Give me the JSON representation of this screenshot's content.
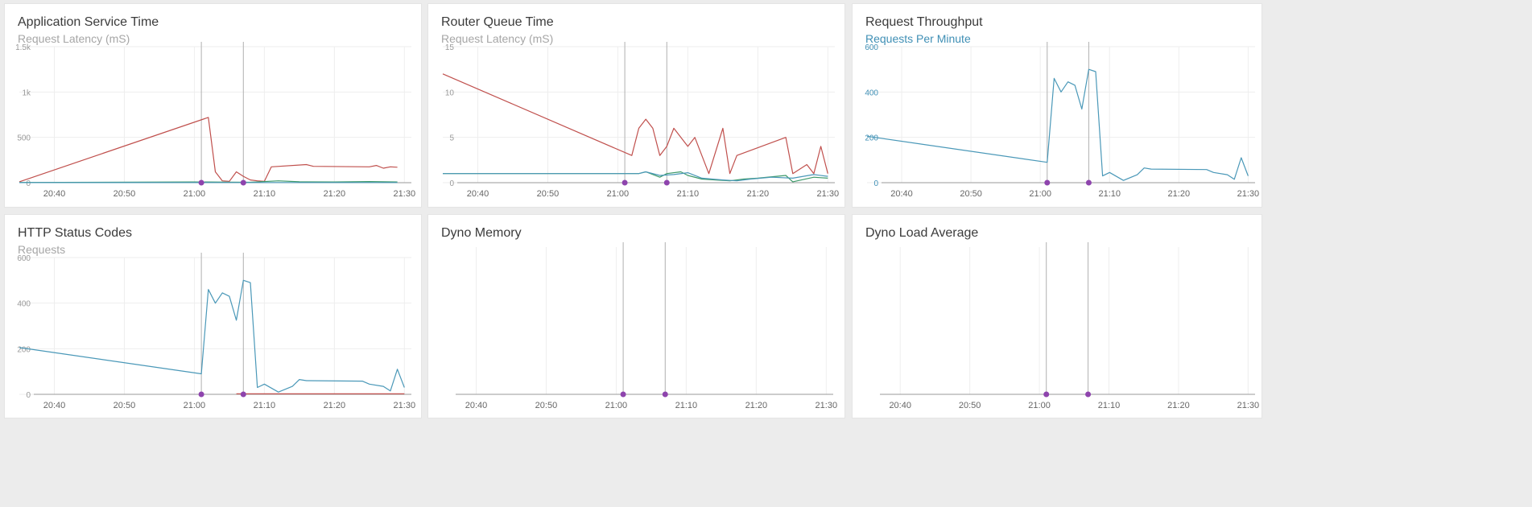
{
  "colors": {
    "red": "#c0504d",
    "green": "#3e9a6a",
    "blue": "#4a98b8",
    "marker": "#8e44ad",
    "grid": "#eeeeee",
    "baseline": "#9a9a9a",
    "event": "#b0b0b0"
  },
  "events": [
    "21:01",
    "21:07"
  ],
  "xticks": [
    "20:40",
    "20:50",
    "21:00",
    "21:10",
    "21:20",
    "21:30"
  ],
  "panels": [
    {
      "title": "Application Service Time",
      "subtitle": "Request Latency (mS)",
      "subtitle_accent": false
    },
    {
      "title": "Router Queue Time",
      "subtitle": "Request Latency (mS)",
      "subtitle_accent": false
    },
    {
      "title": "Request Throughput",
      "subtitle": "Requests Per Minute",
      "subtitle_accent": true
    },
    {
      "title": "HTTP Status Codes",
      "subtitle": "Requests",
      "subtitle_accent": false
    },
    {
      "title": "Dyno Memory",
      "subtitle": "",
      "subtitle_accent": false
    },
    {
      "title": "Dyno Load Average",
      "subtitle": "",
      "subtitle_accent": false
    }
  ],
  "chart_data": [
    {
      "type": "line",
      "title": "Application Service Time",
      "subtitle": "Request Latency (mS)",
      "x_range": [
        "20:35",
        "21:31"
      ],
      "ylim": [
        0,
        1500
      ],
      "yticks": [
        "0",
        "500",
        "1k",
        "1.5k"
      ],
      "ytick_values": [
        0,
        500,
        1000,
        1500
      ],
      "series": [
        {
          "color": "red",
          "points": [
            [
              "20:35",
              10
            ],
            [
              "21:02",
              720
            ],
            [
              "21:03",
              120
            ],
            [
              "21:04",
              20
            ],
            [
              "21:05",
              15
            ],
            [
              "21:06",
              120
            ],
            [
              "21:07",
              70
            ],
            [
              "21:08",
              30
            ],
            [
              "21:09",
              20
            ],
            [
              "21:10",
              15
            ],
            [
              "21:11",
              175
            ],
            [
              "21:16",
              200
            ],
            [
              "21:17",
              180
            ],
            [
              "21:25",
              175
            ],
            [
              "21:26",
              190
            ],
            [
              "21:27",
              160
            ],
            [
              "21:28",
              175
            ],
            [
              "21:29",
              170
            ]
          ]
        },
        {
          "color": "green",
          "points": [
            [
              "20:35",
              3
            ],
            [
              "21:00",
              8
            ],
            [
              "21:05",
              6
            ],
            [
              "21:08",
              4
            ],
            [
              "21:12",
              20
            ],
            [
              "21:15",
              10
            ],
            [
              "21:20",
              8
            ],
            [
              "21:25",
              12
            ],
            [
              "21:29",
              8
            ]
          ]
        },
        {
          "color": "blue",
          "points": [
            [
              "20:35",
              1
            ],
            [
              "21:05",
              2
            ],
            [
              "21:29",
              2
            ]
          ]
        }
      ]
    },
    {
      "type": "line",
      "title": "Router Queue Time",
      "subtitle": "Request Latency (mS)",
      "x_range": [
        "20:35",
        "21:31"
      ],
      "ylim": [
        0,
        15
      ],
      "yticks": [
        "0",
        "5",
        "10",
        "15"
      ],
      "ytick_values": [
        0,
        5,
        10,
        15
      ],
      "series": [
        {
          "color": "red",
          "points": [
            [
              "20:35",
              12
            ],
            [
              "21:02",
              3
            ],
            [
              "21:03",
              6
            ],
            [
              "21:04",
              7
            ],
            [
              "21:05",
              6
            ],
            [
              "21:06",
              3
            ],
            [
              "21:07",
              4
            ],
            [
              "21:08",
              6
            ],
            [
              "21:10",
              4
            ],
            [
              "21:11",
              5
            ],
            [
              "21:13",
              1
            ],
            [
              "21:15",
              6
            ],
            [
              "21:16",
              1
            ],
            [
              "21:17",
              3
            ],
            [
              "21:24",
              5
            ],
            [
              "21:25",
              1
            ],
            [
              "21:27",
              2
            ],
            [
              "21:28",
              1
            ],
            [
              "21:29",
              4
            ],
            [
              "21:30",
              1
            ]
          ]
        },
        {
          "color": "green",
          "points": [
            [
              "20:35",
              1
            ],
            [
              "21:03",
              1
            ],
            [
              "21:04",
              1.2
            ],
            [
              "21:06",
              0.6
            ],
            [
              "21:07",
              1
            ],
            [
              "21:09",
              1.2
            ],
            [
              "21:10",
              0.8
            ],
            [
              "21:12",
              0.4
            ],
            [
              "21:14",
              0.3
            ],
            [
              "21:16",
              0.2
            ],
            [
              "21:18",
              0.4
            ],
            [
              "21:20",
              0.5
            ],
            [
              "21:24",
              0.8
            ],
            [
              "21:25",
              0.1
            ],
            [
              "21:28",
              0.6
            ],
            [
              "21:30",
              0.5
            ]
          ]
        },
        {
          "color": "blue",
          "points": [
            [
              "20:35",
              1
            ],
            [
              "21:03",
              1
            ],
            [
              "21:04",
              1.2
            ],
            [
              "21:06",
              0.8
            ],
            [
              "21:08",
              0.9
            ],
            [
              "21:10",
              1.1
            ],
            [
              "21:12",
              0.5
            ],
            [
              "21:15",
              0.3
            ],
            [
              "21:17",
              0.2
            ],
            [
              "21:19",
              0.4
            ],
            [
              "21:22",
              0.6
            ],
            [
              "21:25",
              0.5
            ],
            [
              "21:28",
              0.9
            ],
            [
              "21:30",
              0.7
            ]
          ]
        }
      ]
    },
    {
      "type": "line",
      "title": "Request Throughput",
      "subtitle": "Requests Per Minute",
      "x_range": [
        "20:35",
        "21:31"
      ],
      "ylim": [
        0,
        600
      ],
      "yticks": [
        "0",
        "200",
        "400",
        "600"
      ],
      "ytick_values": [
        0,
        200,
        400,
        600
      ],
      "series": [
        {
          "color": "blue",
          "points": [
            [
              "20:35",
              205
            ],
            [
              "21:01",
              90
            ],
            [
              "21:02",
              460
            ],
            [
              "21:03",
              400
            ],
            [
              "21:04",
              445
            ],
            [
              "21:05",
              430
            ],
            [
              "21:06",
              325
            ],
            [
              "21:07",
              500
            ],
            [
              "21:08",
              490
            ],
            [
              "21:09",
              30
            ],
            [
              "21:10",
              45
            ],
            [
              "21:12",
              10
            ],
            [
              "21:14",
              35
            ],
            [
              "21:15",
              65
            ],
            [
              "21:16",
              60
            ],
            [
              "21:24",
              58
            ],
            [
              "21:25",
              45
            ],
            [
              "21:27",
              35
            ],
            [
              "21:28",
              15
            ],
            [
              "21:29",
              110
            ],
            [
              "21:30",
              30
            ]
          ]
        }
      ]
    },
    {
      "type": "line",
      "title": "HTTP Status Codes",
      "subtitle": "Requests",
      "x_range": [
        "20:35",
        "21:31"
      ],
      "ylim": [
        0,
        600
      ],
      "yticks": [
        "0",
        "200",
        "400",
        "600"
      ],
      "ytick_values": [
        0,
        200,
        400,
        600
      ],
      "series": [
        {
          "color": "blue",
          "points": [
            [
              "20:35",
              205
            ],
            [
              "21:01",
              90
            ],
            [
              "21:02",
              460
            ],
            [
              "21:03",
              400
            ],
            [
              "21:04",
              445
            ],
            [
              "21:05",
              430
            ],
            [
              "21:06",
              325
            ],
            [
              "21:07",
              500
            ],
            [
              "21:08",
              490
            ],
            [
              "21:09",
              30
            ],
            [
              "21:10",
              45
            ],
            [
              "21:12",
              10
            ],
            [
              "21:14",
              35
            ],
            [
              "21:15",
              65
            ],
            [
              "21:16",
              60
            ],
            [
              "21:24",
              58
            ],
            [
              "21:25",
              45
            ],
            [
              "21:27",
              35
            ],
            [
              "21:28",
              15
            ],
            [
              "21:29",
              110
            ],
            [
              "21:30",
              30
            ]
          ]
        },
        {
          "color": "red",
          "points": [
            [
              "21:06",
              2
            ],
            [
              "21:30",
              2
            ]
          ]
        }
      ]
    },
    {
      "type": "line",
      "title": "Dyno Memory",
      "x_range": [
        "20:35",
        "21:31"
      ],
      "yticks": [],
      "series": []
    },
    {
      "type": "line",
      "title": "Dyno Load Average",
      "x_range": [
        "20:35",
        "21:31"
      ],
      "yticks": [],
      "series": []
    }
  ]
}
